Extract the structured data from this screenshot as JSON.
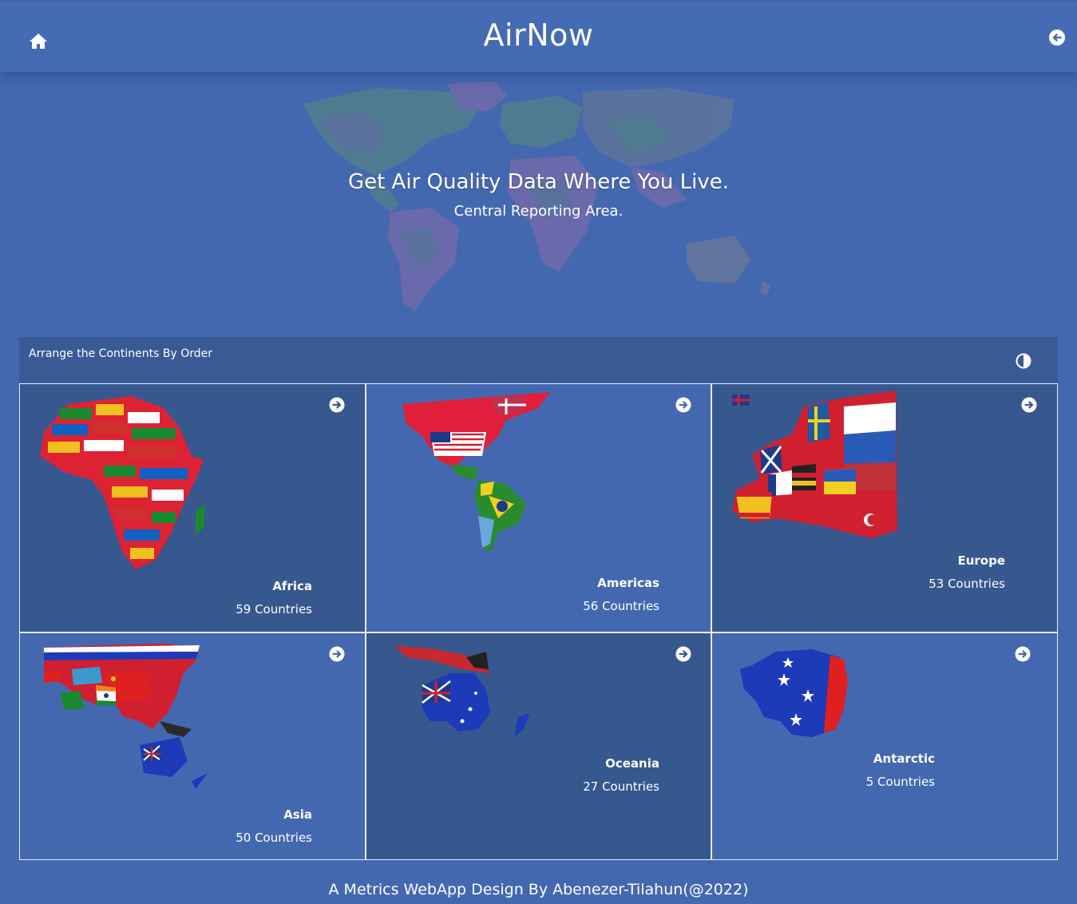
{
  "header": {
    "title": "AirNow",
    "home_icon": "home-icon",
    "back_icon": "arrow-left-circle-icon"
  },
  "hero": {
    "headline": "Get Air Quality Data Where You Live.",
    "subheadline": "Central Reporting Area."
  },
  "filter_bar": {
    "label": "Arrange the Continents By Order",
    "toggle_icon": "contrast-icon"
  },
  "continents": [
    {
      "name": "Africa",
      "count": "59 Countries"
    },
    {
      "name": "Americas",
      "count": "56 Countries"
    },
    {
      "name": "Europe",
      "count": "53 Countries"
    },
    {
      "name": "Asia",
      "count": "50 Countries"
    },
    {
      "name": "Oceania",
      "count": "27 Countries"
    },
    {
      "name": "Antarctic",
      "count": "5 Countries"
    }
  ],
  "footer": {
    "text": "A Metrics WebApp Design By Abenezer-Tilahun(@2022)"
  },
  "colors": {
    "background": "#4468b0",
    "card_dark": "#37578f",
    "filter_bar": "#3a5a96"
  }
}
